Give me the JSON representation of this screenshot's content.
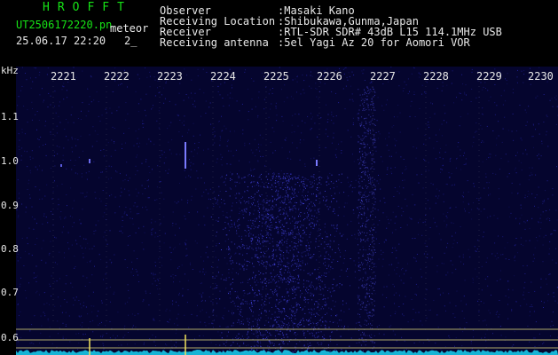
{
  "header": {
    "brand": "HROFFT",
    "file_name": "UT2506172220.pn",
    "mode": "meteor",
    "datetime": "25.06.17 22:20",
    "page_indicator": "2_"
  },
  "station_info": [
    {
      "label": "Observer",
      "value": ":Masaki Kano"
    },
    {
      "label": "Receiving Location",
      "value": ":Shibukawa,Gunma,Japan"
    },
    {
      "label": "Receiver",
      "value": ":RTL-SDR SDR# 43dB L15 114.1MHz USB"
    },
    {
      "label": "Receiving antenna",
      "value": ":5el Yagi Az 20 for Aomori VOR"
    }
  ],
  "y_axis": {
    "title": "kHz",
    "ticks": [
      "1.1",
      "1.0",
      "0.9",
      "0.8",
      "0.7",
      "0.6"
    ]
  },
  "x_axis": {
    "ticks": [
      "2221",
      "2222",
      "2223",
      "2224",
      "2225",
      "2226",
      "2227",
      "2228",
      "2229",
      "2230"
    ]
  },
  "colors": {
    "background": "#000000",
    "plot_bg": "#05052e",
    "noise": "#2a2ab8",
    "grid": "#8a8a9c",
    "ref_lines": "#b0a96a",
    "spectrum": "#18c8e8",
    "spike": "#f2e25a"
  }
}
